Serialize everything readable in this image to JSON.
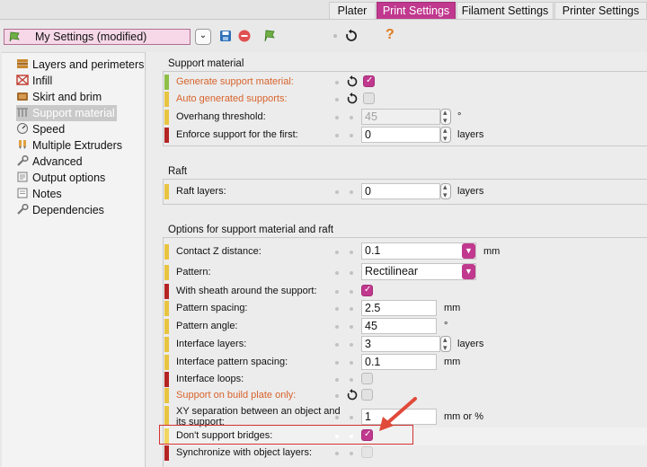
{
  "tabs": [
    {
      "label": "Plater",
      "active": false
    },
    {
      "label": "Print Settings",
      "active": true
    },
    {
      "label": "Filament Settings",
      "active": false
    },
    {
      "label": "Printer Settings",
      "active": false
    }
  ],
  "toolbar": {
    "preset_name": "My Settings (modified)",
    "icons": [
      "flag-icon",
      "dropdown-icon",
      "save-icon",
      "delete-icon",
      "compare-icon",
      "undo-icon",
      "help-icon"
    ],
    "help_glyph": "?",
    "accent": "#c0398e"
  },
  "sidebar": {
    "items": [
      {
        "label": "Layers and perimeters",
        "icon": "layers-icon"
      },
      {
        "label": "Infill",
        "icon": "infill-icon"
      },
      {
        "label": "Skirt and brim",
        "icon": "skirt-icon"
      },
      {
        "label": "Support material",
        "icon": "support-icon",
        "selected": true
      },
      {
        "label": "Speed",
        "icon": "speed-icon"
      },
      {
        "label": "Multiple Extruders",
        "icon": "extruders-icon"
      },
      {
        "label": "Advanced",
        "icon": "wrench-icon"
      },
      {
        "label": "Output options",
        "icon": "output-icon"
      },
      {
        "label": "Notes",
        "icon": "notes-icon"
      },
      {
        "label": "Dependencies",
        "icon": "wrench-icon"
      }
    ]
  },
  "sections": {
    "support": {
      "title": "Support material",
      "generate": "Generate support material:",
      "auto": "Auto generated supports:",
      "overhang": "Overhang threshold:",
      "overhang_value": "45",
      "overhang_unit": "°",
      "enforce": "Enforce support for the first:",
      "enforce_value": "0",
      "enforce_unit": "layers"
    },
    "raft": {
      "title": "Raft",
      "layers": "Raft layers:",
      "layers_value": "0",
      "layers_unit": "layers"
    },
    "options": {
      "title": "Options for support material and raft",
      "contact_z": "Contact Z distance:",
      "contact_z_value": "0.1",
      "contact_z_unit": "mm",
      "pattern": "Pattern:",
      "pattern_value": "Rectilinear",
      "sheath": "With sheath around the support:",
      "spacing": "Pattern spacing:",
      "spacing_value": "2.5",
      "spacing_unit": "mm",
      "angle": "Pattern angle:",
      "angle_value": "45",
      "angle_unit": "°",
      "iface_layers": "Interface layers:",
      "iface_layers_value": "3",
      "iface_layers_unit": "layers",
      "iface_spacing": "Interface pattern spacing:",
      "iface_spacing_value": "0.1",
      "iface_spacing_unit": "mm",
      "iface_loops": "Interface loops:",
      "build_plate": "Support on build plate only:",
      "xy_sep_line1": "XY separation between an object and",
      "xy_sep_line2": "its support:",
      "xy_sep_value": "1",
      "xy_sep_unit": "mm or %",
      "bridges": "Don't support bridges:",
      "sync": "Synchronize with object layers:"
    }
  },
  "mode_colors": {
    "simple": "#8dbf46",
    "advanced": "#e8c441",
    "expert": "#b52424"
  }
}
